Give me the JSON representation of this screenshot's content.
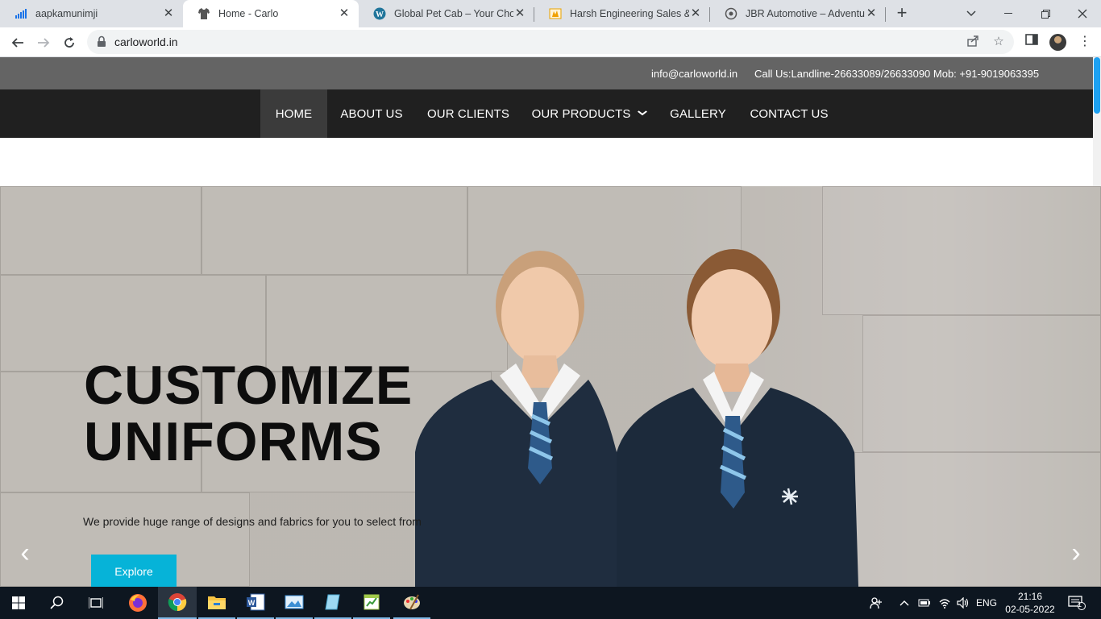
{
  "browser": {
    "tabs": [
      {
        "title": "aapkamunimji",
        "icon": "bar-chart-icon",
        "active": false
      },
      {
        "title": "Home - Carlo",
        "icon": "shirt-icon",
        "active": true
      },
      {
        "title": "Global Pet Cab – Your Choice",
        "icon": "wordpress-icon",
        "active": false
      },
      {
        "title": "Harsh Engineering Sales & Se",
        "icon": "flame-icon",
        "active": false
      },
      {
        "title": "JBR Automotive – Adventure",
        "icon": "jbr-icon",
        "active": false
      }
    ],
    "new_tab": "+",
    "url": "carloworld.in"
  },
  "site": {
    "topbar": {
      "email": "info@carloworld.in",
      "call": "Call Us:Landline-26633089/26633090 Mob: +91-9019063395"
    },
    "nav": {
      "home": "HOME",
      "about": "ABOUT US",
      "clients": "OUR CLIENTS",
      "products": "OUR PRODUCTS",
      "gallery": "GALLERY",
      "contact": "CONTACT US"
    },
    "hero": {
      "title_line1": "CUSTOMIZE",
      "title_line2": "UNIFORMS",
      "subtitle": "We provide huge range of designs and fabrics for you to select from",
      "button": "Explore",
      "prev_arrow": "‹",
      "next_arrow": "›"
    }
  },
  "taskbar": {
    "lang": "ENG",
    "time": "21:16",
    "date": "02-05-2022",
    "notification_count": "1"
  },
  "colors": {
    "accent_cyan": "#06b3d8",
    "nav_bg": "#202020",
    "topbar_bg": "#646464",
    "taskbar_bg": "#0d1620"
  }
}
